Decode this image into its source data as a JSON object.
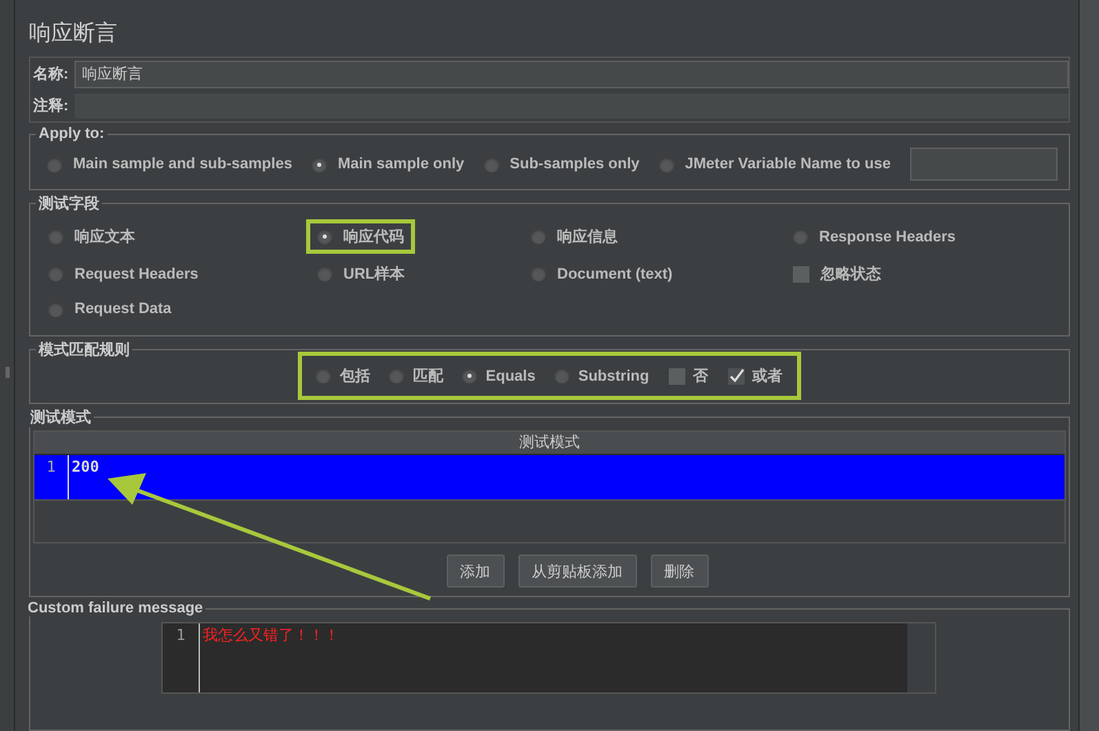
{
  "title": "响应断言",
  "name_field": {
    "label": "名称:",
    "value": "响应断言"
  },
  "comment_field": {
    "label": "注释:"
  },
  "apply_to": {
    "legend": "Apply to:",
    "options": [
      {
        "label": "Main sample and sub-samples",
        "selected": false
      },
      {
        "label": "Main sample only",
        "selected": true
      },
      {
        "label": "Sub-samples only",
        "selected": false
      },
      {
        "label": "JMeter Variable Name to use",
        "selected": false
      }
    ]
  },
  "test_field": {
    "legend": "测试字段",
    "items": [
      {
        "kind": "radio",
        "label": "响应文本",
        "selected": false,
        "highlighted": false
      },
      {
        "kind": "radio",
        "label": "响应代码",
        "selected": true,
        "highlighted": true
      },
      {
        "kind": "radio",
        "label": "响应信息",
        "selected": false,
        "highlighted": false
      },
      {
        "kind": "radio",
        "label": "Response Headers",
        "selected": false,
        "highlighted": false
      },
      {
        "kind": "radio",
        "label": "Request Headers",
        "selected": false,
        "highlighted": false
      },
      {
        "kind": "radio",
        "label": "URL样本",
        "selected": false,
        "highlighted": false
      },
      {
        "kind": "radio",
        "label": "Document (text)",
        "selected": false,
        "highlighted": false
      },
      {
        "kind": "checkbox",
        "label": "忽略状态",
        "checked": false,
        "highlighted": false
      },
      {
        "kind": "radio",
        "label": "Request Data",
        "selected": false,
        "highlighted": false
      }
    ]
  },
  "pattern_rules": {
    "legend": "模式匹配规则",
    "highlighted": true,
    "items": [
      {
        "kind": "radio",
        "label": "包括",
        "selected": false
      },
      {
        "kind": "radio",
        "label": "匹配",
        "selected": false
      },
      {
        "kind": "radio",
        "label": "Equals",
        "selected": true
      },
      {
        "kind": "radio",
        "label": "Substring",
        "selected": false
      },
      {
        "kind": "checkbox",
        "label": "否",
        "checked": false
      },
      {
        "kind": "checkbox",
        "label": "或者",
        "checked": true
      }
    ]
  },
  "test_patterns": {
    "legend": "测试模式",
    "column": "测试模式",
    "rows": [
      {
        "line": "1",
        "value": "200",
        "selected": true
      }
    ],
    "buttons": [
      "添加",
      "从剪贴板添加",
      "删除"
    ]
  },
  "failure_message": {
    "legend": "Custom failure message",
    "lines": [
      {
        "line": "1",
        "text": "我怎么又错了！！！"
      }
    ]
  }
}
